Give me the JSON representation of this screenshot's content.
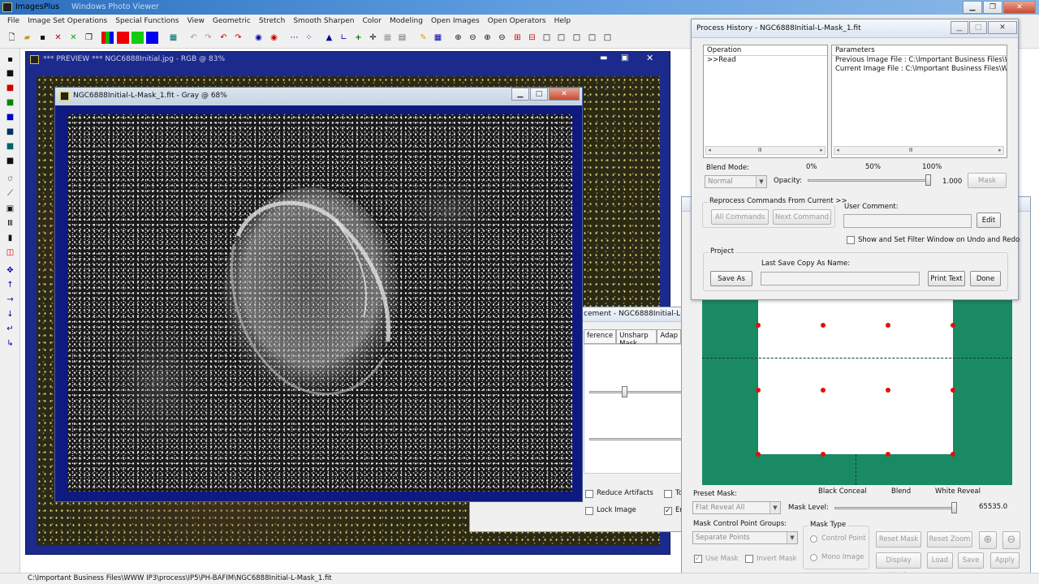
{
  "app": {
    "title": "ImagesPlus",
    "subtitle": "Windows Photo Viewer"
  },
  "menu": [
    "File",
    "Image Set Operations",
    "Special Functions",
    "View",
    "Geometric",
    "Stretch",
    "Smooth Sharpen",
    "Color",
    "Modeling",
    "Open Images",
    "Open Operators",
    "Help"
  ],
  "preview_window": {
    "title": "*** PREVIEW *** NGC6888Initial.jpg - RGB @ 83%"
  },
  "mask_window": {
    "title": "NGC6888Initial-L-Mask_1.fit - Gray @ 68%"
  },
  "enhancement_window": {
    "title": "cement - NGC6888Initial-L",
    "tabs": [
      "ference",
      "Unsharp Mask",
      "Adap"
    ],
    "reduce_artifacts": "Reduce Artifacts",
    "lock_image": "Lock Image",
    "to_label": "To",
    "en_label": "En"
  },
  "process_history": {
    "title": "Process History - NGC6888Initial-L-Mask_1.fit",
    "operation_header": "Operation",
    "operations": [
      ">>Read"
    ],
    "parameters_header": "Parameters",
    "parameters": [
      "Previous Image File : C:\\Important Business Files\\WW...",
      "Current Image File : C:\\Important Business Files\\WW..."
    ],
    "blend_mode_label": "Blend Mode:",
    "blend_mode_value": "Normal",
    "opacity_label": "Opacity:",
    "pct_0": "0%",
    "pct_50": "50%",
    "pct_100": "100%",
    "opacity_value": "1.000",
    "opacity_level": 1.0,
    "mask_button": "Mask",
    "reprocess_group": "Reprocess Commands From Current >>",
    "all_commands": "All Commands",
    "next_command": "Next Command",
    "user_comment_label": "User Comment:",
    "edit_button": "Edit",
    "show_filter_label": "Show and Set Filter Window on Undo and Redo",
    "project_group": "Project",
    "last_save_label": "Last Save Copy As Name:",
    "save_as_button": "Save As",
    "print_text_button": "Print Text",
    "done_button": "Done"
  },
  "mask_panel": {
    "preset_mask_label": "Preset Mask:",
    "preset_mask_value": "Flat Reveal All",
    "black_conceal": "Black Conceal",
    "blend": "Blend",
    "white_reveal": "White Reveal",
    "mask_level_label": "Mask Level:",
    "mask_level_value": "65535.0",
    "mask_level_fraction": 1.0,
    "cp_groups_label": "Mask Control Point Groups:",
    "cp_groups_value": "Separate Points",
    "mask_type_group": "Mask Type",
    "control_point": "Control Point",
    "mono_image": "Mono Image",
    "reset_mask": "Reset Mask",
    "reset_zoom": "Reset Zoom",
    "use_mask": "Use Mask",
    "invert_mask": "Invert Mask",
    "display_mask": "Display Mask",
    "load": "Load",
    "save": "Save",
    "apply": "Apply"
  },
  "status_bar": {
    "path": "C:\\Important Business Files\\WWW IP3\\process\\IP5\\PH-BAFIM\\NGC6888Initial-L-Mask_1.fit"
  },
  "colors": {
    "title_bar": "#2a6fbf",
    "workspace": "#ffffff",
    "image_frame": "#1b2a8c",
    "mask_green": "#1a8a65",
    "control_point": "#e01010"
  }
}
